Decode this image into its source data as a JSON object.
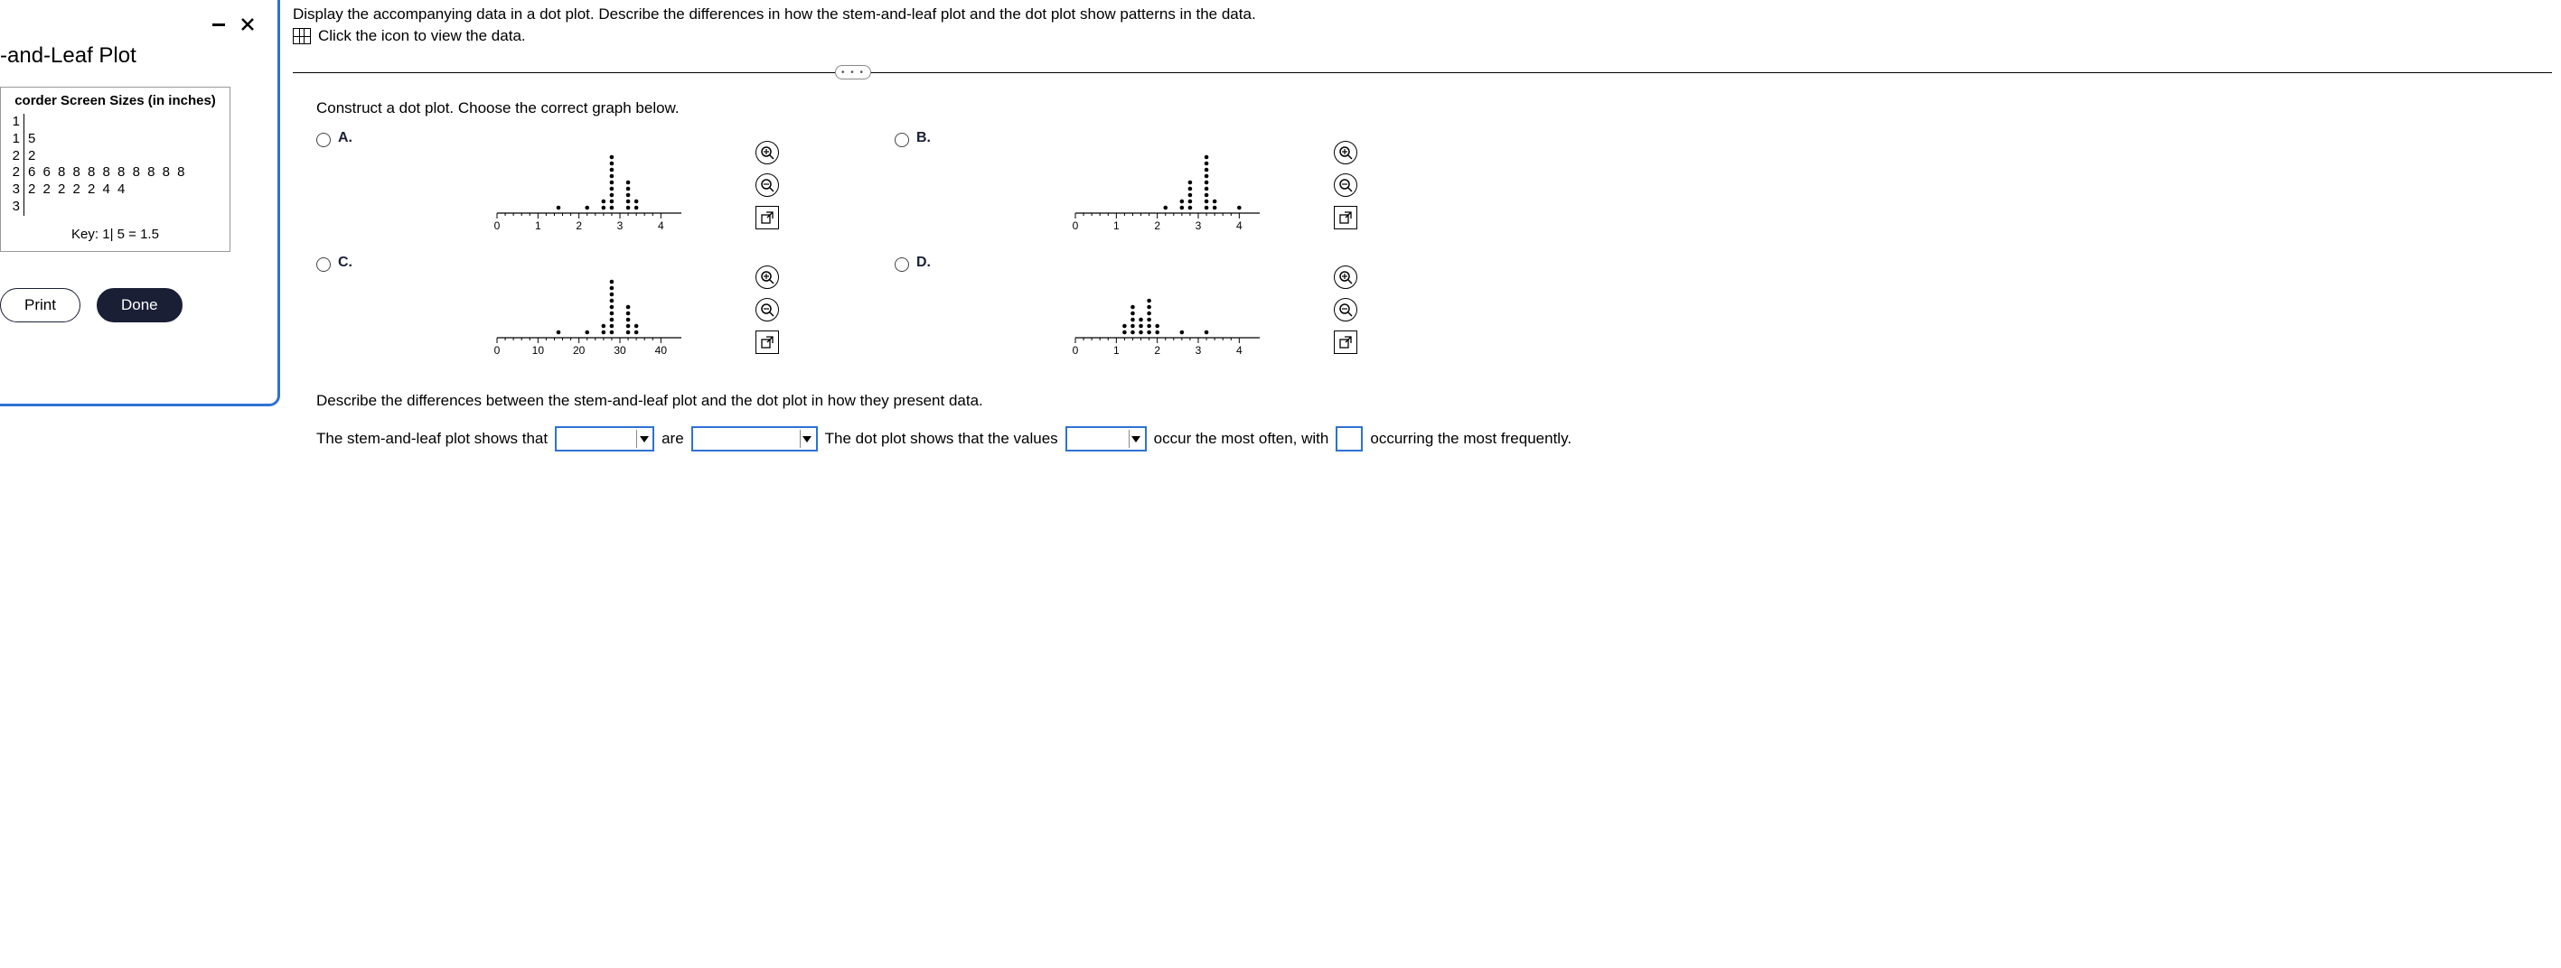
{
  "modal": {
    "title": "-and-Leaf Plot",
    "data_title": "corder Screen Sizes (in inches)",
    "key_text": "Key: 1| 5 = 1.5",
    "print_label": "Print",
    "done_label": "Done",
    "stem_leaf": [
      {
        "stem": "1",
        "leaf": ""
      },
      {
        "stem": "1",
        "leaf": "5"
      },
      {
        "stem": "2",
        "leaf": "2"
      },
      {
        "stem": "2",
        "leaf": "6 6 8 8 8 8 8 8 8 8 8"
      },
      {
        "stem": "3",
        "leaf": "2 2 2 2 2 4 4"
      },
      {
        "stem": "3",
        "leaf": ""
      }
    ]
  },
  "instructions": {
    "line1": "Display the accompanying data in a dot plot. Describe the differences in how the stem-and-leaf plot and the dot plot show patterns in the data.",
    "line2": "Click the icon to view the data."
  },
  "question": {
    "prompt": "Construct a dot plot. Choose the correct graph below.",
    "options": {
      "A": "A.",
      "B": "B.",
      "C": "C.",
      "D": "D."
    }
  },
  "axes": {
    "small": [
      "0",
      "1",
      "2",
      "3",
      "4"
    ],
    "large": [
      "0",
      "10",
      "20",
      "30",
      "40"
    ]
  },
  "describe": {
    "text": "Describe the differences between the stem-and-leaf plot and the dot plot in how they present data.",
    "part1": "The stem-and-leaf plot shows that",
    "mid": "are",
    "part2": "The dot plot shows that the values",
    "part3": "occur the most often, with",
    "part4": "occurring the most frequently."
  },
  "pill": "• • •",
  "chart_data": [
    {
      "option": "A",
      "type": "dot-plot",
      "x_ticks": [
        0,
        1,
        2,
        3,
        4
      ],
      "xlim": [
        0,
        4.5
      ],
      "stacks": [
        {
          "x": 1.5,
          "count": 1
        },
        {
          "x": 2.2,
          "count": 1
        },
        {
          "x": 2.6,
          "count": 2
        },
        {
          "x": 2.8,
          "count": 9
        },
        {
          "x": 3.2,
          "count": 5
        },
        {
          "x": 3.4,
          "count": 2
        }
      ]
    },
    {
      "option": "B",
      "type": "dot-plot",
      "x_ticks": [
        0,
        1,
        2,
        3,
        4
      ],
      "xlim": [
        0,
        4.5
      ],
      "stacks": [
        {
          "x": 2.2,
          "count": 1
        },
        {
          "x": 2.6,
          "count": 2
        },
        {
          "x": 2.8,
          "count": 5
        },
        {
          "x": 3.2,
          "count": 9
        },
        {
          "x": 3.4,
          "count": 2
        },
        {
          "x": 4.0,
          "count": 1
        }
      ]
    },
    {
      "option": "C",
      "type": "dot-plot",
      "x_ticks": [
        0,
        10,
        20,
        30,
        40
      ],
      "xlim": [
        0,
        45
      ],
      "stacks": [
        {
          "x": 15,
          "count": 1
        },
        {
          "x": 22,
          "count": 1
        },
        {
          "x": 26,
          "count": 2
        },
        {
          "x": 28,
          "count": 9
        },
        {
          "x": 32,
          "count": 5
        },
        {
          "x": 34,
          "count": 2
        }
      ]
    },
    {
      "option": "D",
      "type": "dot-plot",
      "x_ticks": [
        0,
        1,
        2,
        3,
        4
      ],
      "xlim": [
        0,
        4.5
      ],
      "stacks": [
        {
          "x": 1.2,
          "count": 2
        },
        {
          "x": 1.4,
          "count": 5
        },
        {
          "x": 1.6,
          "count": 3
        },
        {
          "x": 1.8,
          "count": 6
        },
        {
          "x": 2.0,
          "count": 2
        },
        {
          "x": 2.6,
          "count": 1
        },
        {
          "x": 3.2,
          "count": 1
        }
      ]
    }
  ]
}
